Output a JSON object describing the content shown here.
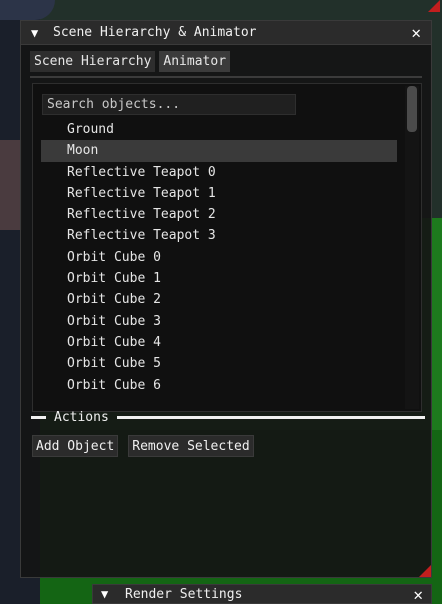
{
  "main_window": {
    "title": "Scene Hierarchy & Animator",
    "collapse_glyph": "▼",
    "close_glyph": "✕",
    "tabs": [
      {
        "label": "Scene Hierarchy",
        "active": true
      },
      {
        "label": "Animator",
        "active": false
      }
    ],
    "search": {
      "placeholder": "Search objects...",
      "value": ""
    },
    "objects": [
      {
        "label": "Ground",
        "selected": false
      },
      {
        "label": "Moon",
        "selected": true
      },
      {
        "label": "Reflective Teapot 0",
        "selected": false
      },
      {
        "label": "Reflective Teapot 1",
        "selected": false
      },
      {
        "label": "Reflective Teapot 2",
        "selected": false
      },
      {
        "label": "Reflective Teapot 3",
        "selected": false
      },
      {
        "label": "Orbit Cube 0",
        "selected": false
      },
      {
        "label": "Orbit Cube 1",
        "selected": false
      },
      {
        "label": "Orbit Cube 2",
        "selected": false
      },
      {
        "label": "Orbit Cube 3",
        "selected": false
      },
      {
        "label": "Orbit Cube 4",
        "selected": false
      },
      {
        "label": "Orbit Cube 5",
        "selected": false
      },
      {
        "label": "Orbit Cube 6",
        "selected": false
      }
    ],
    "actions_header": "Actions",
    "buttons": {
      "add": "Add Object",
      "remove": "Remove Selected"
    }
  },
  "render_window": {
    "title": "Render Settings",
    "collapse_glyph": "▼",
    "close_glyph": "✕"
  },
  "colors": {
    "accent_grip": "#c21e1e",
    "window_bg": "#141414",
    "titlebar_bg": "#2b2b2b",
    "selected_row": "#3a3a3a",
    "scene_ground": "#1d7a1d"
  }
}
